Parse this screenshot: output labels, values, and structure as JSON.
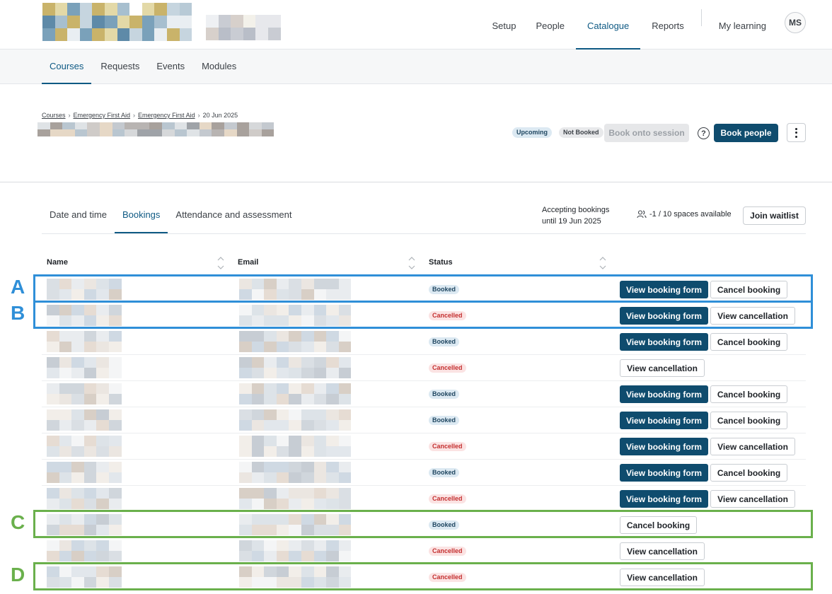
{
  "header": {
    "nav": [
      {
        "label": "Setup",
        "active": false
      },
      {
        "label": "People",
        "active": false
      },
      {
        "label": "Catalogue",
        "active": true
      },
      {
        "label": "Reports",
        "active": false
      }
    ],
    "my_learning": "My learning",
    "avatar_initials": "MS"
  },
  "subnav": [
    {
      "label": "Courses",
      "active": true
    },
    {
      "label": "Requests",
      "active": false
    },
    {
      "label": "Events",
      "active": false
    },
    {
      "label": "Modules",
      "active": false
    }
  ],
  "breadcrumb": {
    "items": [
      "Courses",
      "Emergency First Aid",
      "Emergency First Aid"
    ],
    "current": "20 Jun 2025"
  },
  "session": {
    "status_pills": [
      "Upcoming",
      "Not Booked"
    ],
    "book_onto_session": "Book onto session",
    "book_people": "Book people"
  },
  "tabs": [
    {
      "label": "Date and time",
      "active": false
    },
    {
      "label": "Bookings",
      "active": true
    },
    {
      "label": "Attendance and assessment",
      "active": false
    }
  ],
  "booking_info": {
    "accepting_line1": "Accepting bookings",
    "accepting_line2": "until 19 Jun 2025",
    "spaces": "-1 / 10 spaces available",
    "join_waitlist": "Join waitlist"
  },
  "table": {
    "headers": [
      "Name",
      "Email",
      "Status"
    ],
    "rows": [
      {
        "status": "Booked",
        "actions": [
          "View booking form",
          "Cancel booking"
        ]
      },
      {
        "status": "Cancelled",
        "actions": [
          "View booking form",
          "View cancellation"
        ]
      },
      {
        "status": "Booked",
        "actions": [
          "View booking form",
          "Cancel booking"
        ]
      },
      {
        "status": "Cancelled",
        "actions": [
          "View cancellation"
        ]
      },
      {
        "status": "Booked",
        "actions": [
          "View booking form",
          "Cancel booking"
        ]
      },
      {
        "status": "Booked",
        "actions": [
          "View booking form",
          "Cancel booking"
        ]
      },
      {
        "status": "Cancelled",
        "actions": [
          "View booking form",
          "View cancellation"
        ]
      },
      {
        "status": "Booked",
        "actions": [
          "View booking form",
          "Cancel booking"
        ]
      },
      {
        "status": "Cancelled",
        "actions": [
          "View booking form",
          "View cancellation"
        ]
      },
      {
        "status": "Booked",
        "actions": [
          "Cancel booking"
        ]
      },
      {
        "status": "Cancelled",
        "actions": [
          "View cancellation"
        ]
      },
      {
        "status": "Cancelled",
        "actions": [
          "View cancellation"
        ]
      }
    ]
  },
  "annotations": [
    {
      "label": "A",
      "color": "#2f8fd8"
    },
    {
      "label": "B",
      "color": "#2f8fd8"
    },
    {
      "label": "C",
      "color": "#6ab04c"
    },
    {
      "label": "D",
      "color": "#6ab04c"
    }
  ],
  "colors": {
    "primary": "#0f4c6e",
    "accent_active": "#0f5a84",
    "booked_bg": "#dce9f2",
    "cancelled_bg": "#fbe3e3",
    "annotation_blue": "#2f8fd8",
    "annotation_green": "#6ab04c"
  },
  "icons": [
    "help-icon",
    "kebab-icon",
    "people-icon",
    "sort-icon"
  ]
}
